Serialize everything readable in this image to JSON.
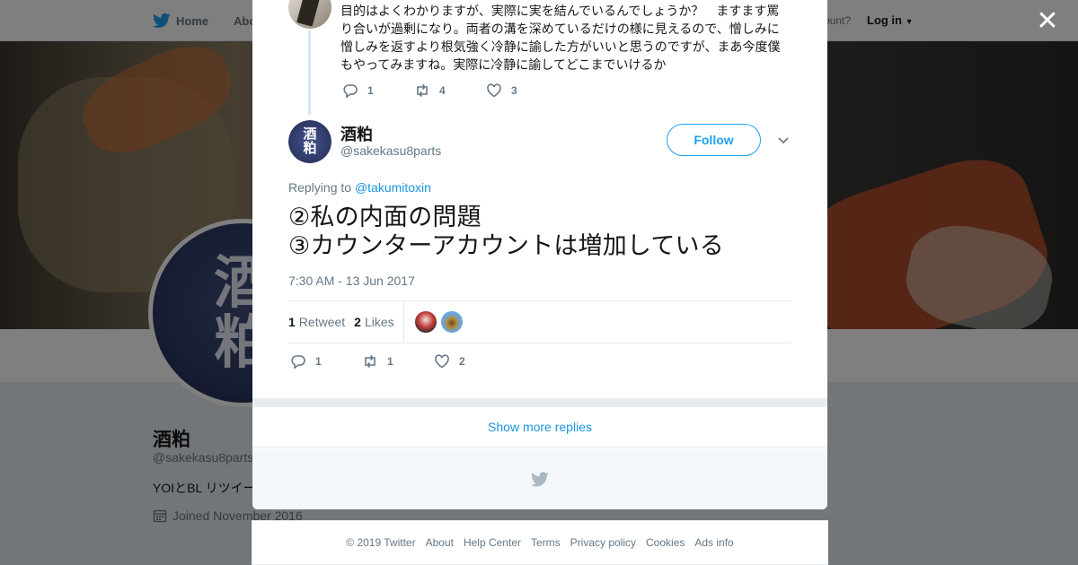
{
  "topbar": {
    "home_label": "Home",
    "about_label": "Abo",
    "account_prompt": "ccount?",
    "login_label": "Log in"
  },
  "profile": {
    "avatar_glyphs": [
      "酒",
      "粕"
    ],
    "name": "酒粕",
    "handle": "@sakekasu8parts",
    "bio": "YOIとBL リツイー",
    "joined": "Joined November 2016"
  },
  "modal": {
    "previous_tweet": {
      "text": "目的はよくわかりますが、実際に実を結んでいるんでしょうか？　ますます罵り合いが過剰になり。両者の溝を深めているだけの様に見えるので、憎しみに憎しみを返すより根気強く冷静に諭した方がいいと思うのですが、まあ今度僕もやってみますね。実際に冷静に諭してどこまでいけるか",
      "replies": "1",
      "retweets": "4",
      "likes": "3"
    },
    "tweet": {
      "author_name": "酒粕",
      "author_handle": "@sakekasu8parts",
      "avatar_glyphs": [
        "酒",
        "粕"
      ],
      "follow_label": "Follow",
      "replying_prefix": "Replying to",
      "replying_to": "@takumitoxin",
      "line1": "②私の内面の問題",
      "line2": "③カウンターアカウントは増加している",
      "timestamp": "7:30 AM - 13 Jun 2017",
      "retweet_count": "1",
      "retweet_label": "Retweet",
      "like_count": "2",
      "likes_label": "Likes",
      "replies": "1",
      "retweets": "1",
      "likes": "2"
    },
    "show_more_label": "Show more replies"
  },
  "footer": {
    "copyright": "© 2019 Twitter",
    "links": [
      "About",
      "Help Center",
      "Terms",
      "Privacy policy",
      "Cookies",
      "Ads info"
    ]
  },
  "colors": {
    "accent": "#1da1f2",
    "link": "#1b95e0",
    "muted": "#657786",
    "overlay": "rgba(0,0,0,0.5)"
  },
  "icons": [
    "twitter-bird-icon",
    "caret-down-icon",
    "close-icon",
    "reply-icon",
    "retweet-icon",
    "like-icon",
    "calendar-icon",
    "chevron-down-icon"
  ]
}
